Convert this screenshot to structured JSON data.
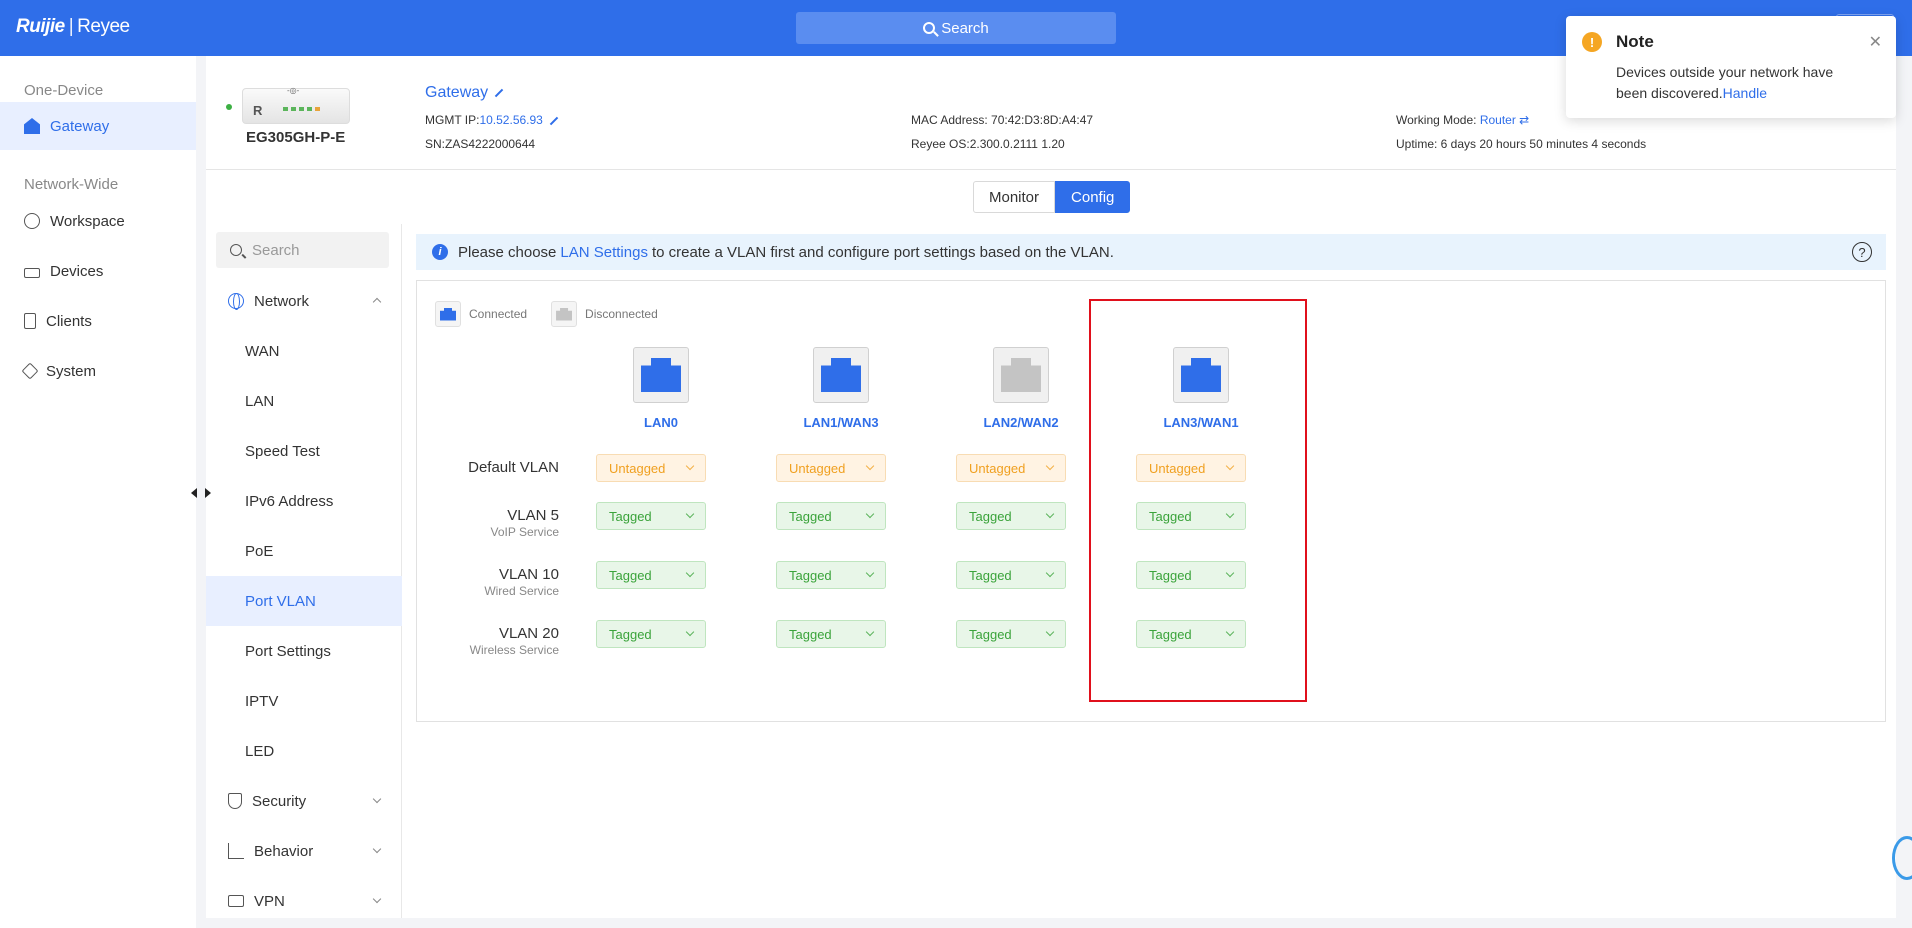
{
  "app": {
    "logo_brand": "Ruijie",
    "logo_sub": "Reyee",
    "search_label": "Search"
  },
  "sidebar": {
    "section1": "One-Device",
    "section2": "Network-Wide",
    "items": [
      {
        "label": "Gateway"
      },
      {
        "label": "Workspace"
      },
      {
        "label": "Devices"
      },
      {
        "label": "Clients"
      },
      {
        "label": "System"
      }
    ]
  },
  "device": {
    "model": "EG305GH-P-E",
    "name": "Gateway",
    "mgmt_ip_label": "MGMT IP:",
    "mgmt_ip": "10.52.56.93",
    "sn": "SN:ZAS4222000644",
    "mac": "MAC Address: 70:42:D3:8D:A4:47",
    "os": "Reyee OS:2.300.0.2111 1.20",
    "working_mode_label": "Working Mode:",
    "working_mode": "Router ⇄",
    "uptime": "Uptime: 6 days 20 hours 50 minutes 4 seconds"
  },
  "tabs": {
    "monitor": "Monitor",
    "config": "Config"
  },
  "submenu": {
    "search_placeholder": "Search",
    "network": "Network",
    "items": [
      "WAN",
      "LAN",
      "Speed Test",
      "IPv6 Address",
      "PoE",
      "Port VLAN",
      "Port Settings",
      "IPTV",
      "LED"
    ],
    "security": "Security",
    "behavior": "Behavior",
    "vpn": "VPN"
  },
  "info": {
    "prefix": "Please choose",
    "link": "LAN Settings",
    "suffix": "to create a VLAN first and configure port settings based on the VLAN."
  },
  "legend": {
    "connected": "Connected",
    "disconnected": "Disconnected"
  },
  "colors": {
    "connected": "#2f6ee9",
    "disconnected": "#c4c4c4"
  },
  "ports": [
    {
      "label": "LAN0",
      "status": "connected"
    },
    {
      "label": "LAN1/WAN3",
      "status": "connected"
    },
    {
      "label": "LAN2/WAN2",
      "status": "disconnected"
    },
    {
      "label": "LAN3/WAN1",
      "status": "connected"
    }
  ],
  "vlans": [
    {
      "name": "Default VLAN",
      "desc": "",
      "values": [
        "Untagged",
        "Untagged",
        "Untagged",
        "Untagged"
      ]
    },
    {
      "name": "VLAN 5",
      "desc": "VoIP Service",
      "values": [
        "Tagged",
        "Tagged",
        "Tagged",
        "Tagged"
      ]
    },
    {
      "name": "VLAN 10",
      "desc": "Wired Service",
      "values": [
        "Tagged",
        "Tagged",
        "Tagged",
        "Tagged"
      ]
    },
    {
      "name": "VLAN 20",
      "desc": "Wireless Service",
      "values": [
        "Tagged",
        "Tagged",
        "Tagged",
        "Tagged"
      ]
    }
  ],
  "toast": {
    "title": "Note",
    "message": "Devices outside your network have been discovered.",
    "link": "Handle"
  }
}
